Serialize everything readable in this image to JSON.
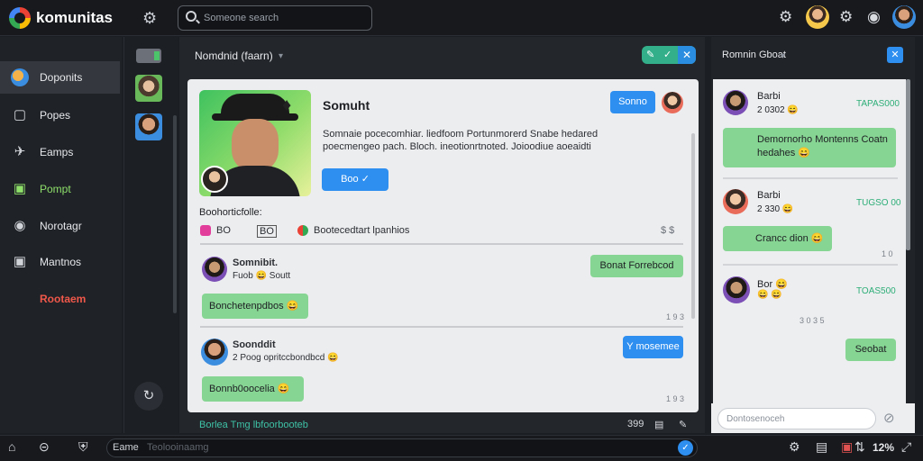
{
  "app": {
    "title": "komunitas"
  },
  "search": {
    "placeholder": "Someone search"
  },
  "sidebar": {
    "items": [
      {
        "label": "Doponits",
        "icon": "globe-icon",
        "active": true
      },
      {
        "label": "Popes",
        "icon": "square-icon"
      },
      {
        "label": "Eamps",
        "icon": "pin-icon"
      },
      {
        "label": "Pompt",
        "icon": "note-icon"
      },
      {
        "label": "Norotagr",
        "icon": "disc-icon"
      },
      {
        "label": "Mantnos",
        "icon": "lock-icon"
      },
      {
        "label": "Rootaem",
        "icon": "",
        "danger": true
      }
    ]
  },
  "center": {
    "title": "Nomdnid (faarn)",
    "profile": {
      "name": "Somuht",
      "description": "Somnaie pocecomhiar. liedfoom Portunmorerd Snabe hedared poecmengeo pach. Bloch. ineotionrtnoted. Joioodiue aoeaidti",
      "follow_label": "Boo",
      "top_button_label": "Sonno"
    },
    "section_title": "Boohorticfolle:",
    "tags": {
      "count": "BO",
      "box": "BO",
      "link": "Bootecedtart lpanhios",
      "right": "$ $"
    },
    "messages": [
      {
        "name": "Somnibit.",
        "meta": "Fuob 😄 Soutt",
        "right_label": "Bonat Forrebcod",
        "bubble": "Bonchetenpdbos 😄",
        "time": "1 9 3"
      },
      {
        "name": "Soonddit",
        "meta": "2 Poog opritccbondbcd 😄",
        "right_label": "Y mosemee",
        "bubble": "Bonnb0oocelia 😄",
        "time": "1 9 3"
      }
    ],
    "footer": {
      "left": "Borlea  Tmg lbfoorbooteb",
      "count": "399"
    }
  },
  "right_panel": {
    "title": "Romnin Gboat",
    "items": [
      {
        "name": "Barbi",
        "sub": "2 0302 😄",
        "tag": "TAPAS000",
        "bubble": "Demornorho Montenns Coatn hedahes 😄"
      },
      {
        "name": "Barbi",
        "sub": "2 330 😄",
        "tag": "TUGSO 00",
        "bubble": "Crancc dion 😄",
        "time": "1 0"
      },
      {
        "name": "Bor 😄",
        "sub": "😄 😄",
        "tag": "TOAS500",
        "time": "3 0  3 5"
      }
    ],
    "reply_bubble": "Seobat",
    "input_placeholder": "Dontosenoceh"
  },
  "bottombar": {
    "label": "Eame",
    "placeholder": "Teolooinaamg",
    "percent": "12%"
  }
}
